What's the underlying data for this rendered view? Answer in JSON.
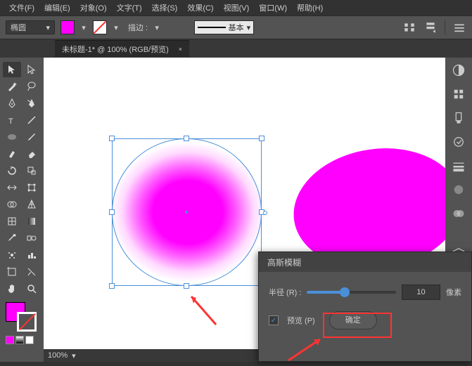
{
  "menu": {
    "file": "文件(F)",
    "edit": "编辑(E)",
    "object": "对象(O)",
    "text": "文字(T)",
    "select": "选择(S)",
    "effect": "效果(C)",
    "view": "视图(V)",
    "window": "窗口(W)",
    "help": "帮助(H)"
  },
  "options": {
    "tool": "椭圆",
    "fill_color": "#ff00ff",
    "stroke_label": "描边 :",
    "stroke_style": "基本"
  },
  "tab": {
    "title": "未标题-1* @ 100% (RGB/预览)",
    "close": "×"
  },
  "dialog": {
    "title": "高斯模糊",
    "radius_label": "半径 (R) :",
    "radius_value": "10",
    "unit": "像素",
    "preview": "预览 (P)",
    "ok": "确定"
  },
  "status": {
    "zoom": "100%"
  },
  "colors": {
    "accent": "#4a90d9",
    "magenta": "#ff00ff",
    "highlight": "#ff3333"
  }
}
